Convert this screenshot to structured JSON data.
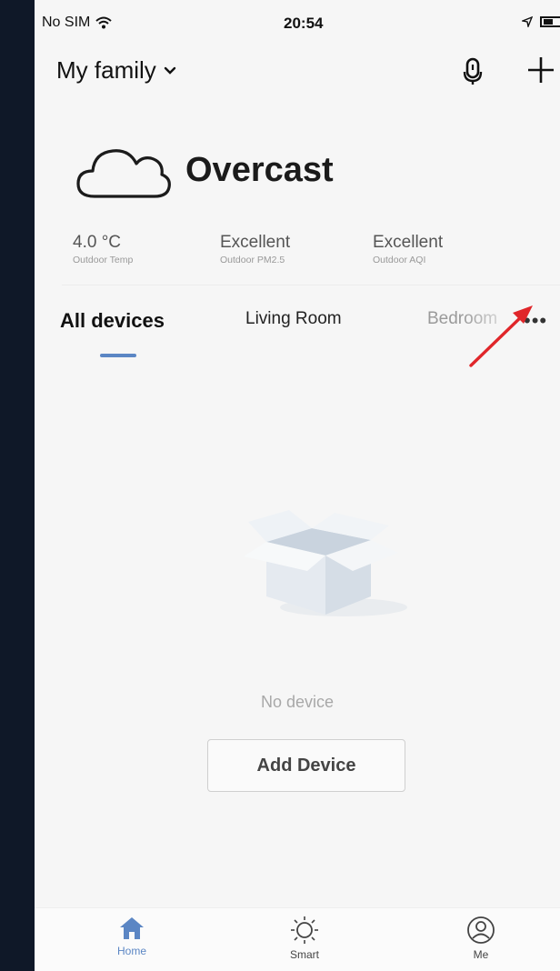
{
  "status_bar": {
    "carrier": "No SIM",
    "time": "20:54"
  },
  "header": {
    "family_name": "My family",
    "icons": [
      "wifi-icon",
      "location-arrow-icon",
      "battery-icon",
      "chevron-down-icon",
      "microphone-icon",
      "plus-icon"
    ]
  },
  "weather": {
    "condition": "Overcast",
    "icon": "cloud-icon",
    "stats": [
      {
        "value": "4.0 °C",
        "label": "Outdoor Temp"
      },
      {
        "value": "Excellent",
        "label": "Outdoor PM2.5"
      },
      {
        "value": "Excellent",
        "label": "Outdoor AQI"
      }
    ]
  },
  "tabs": {
    "items": [
      {
        "label": "All devices",
        "active": true
      },
      {
        "label": "Living Room",
        "active": false
      },
      {
        "label": "Bedroom",
        "active": false
      }
    ],
    "more_icon": "more-dots-icon",
    "accent": "#5b86c4"
  },
  "annotation": {
    "icon": "red-arrow-icon",
    "color": "#e0262a"
  },
  "empty_state": {
    "icon": "empty-box-icon",
    "message": "No device",
    "button_label": "Add Device"
  },
  "bottom_nav": {
    "items": [
      {
        "label": "Home",
        "icon": "home-icon",
        "active": true
      },
      {
        "label": "Smart",
        "icon": "sun-icon",
        "active": false
      },
      {
        "label": "Me",
        "icon": "user-icon",
        "active": false
      }
    ]
  }
}
